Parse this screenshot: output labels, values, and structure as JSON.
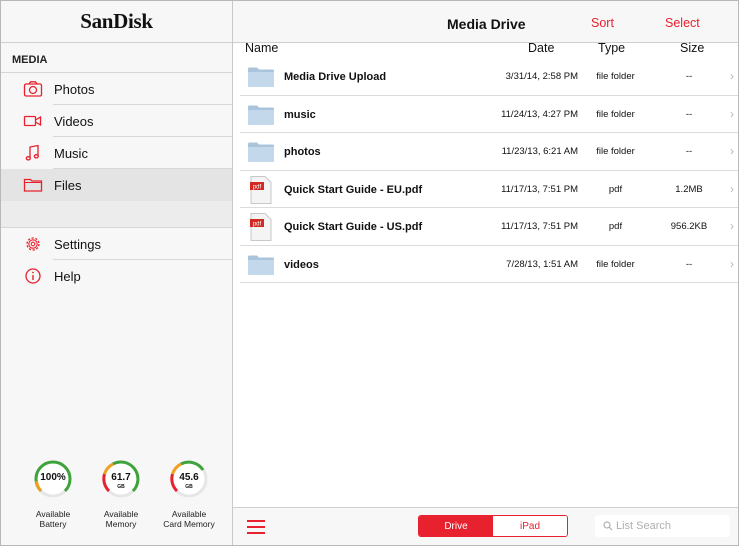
{
  "brand": "SanDisk",
  "sidebar": {
    "section_label": "MEDIA",
    "items": [
      {
        "label": "Photos",
        "icon": "camera-icon"
      },
      {
        "label": "Videos",
        "icon": "video-camera-icon"
      },
      {
        "label": "Music",
        "icon": "music-note-icon"
      },
      {
        "label": "Files",
        "icon": "folder-icon",
        "selected": true
      }
    ],
    "items2": [
      {
        "label": "Settings",
        "icon": "gear-icon"
      },
      {
        "label": "Help",
        "icon": "info-icon"
      }
    ],
    "gauges": [
      {
        "value": "100%",
        "unit": "",
        "label1": "Available",
        "label2": "Battery"
      },
      {
        "value": "61.7",
        "unit": "GB",
        "label1": "Available",
        "label2": "Memory"
      },
      {
        "value": "45.6",
        "unit": "GB",
        "label1": "Available",
        "label2": "Card Memory"
      }
    ]
  },
  "header": {
    "title": "Media Drive",
    "sort_label": "Sort",
    "select_label": "Select"
  },
  "columns": {
    "name": "Name",
    "date": "Date",
    "type": "Type",
    "size": "Size"
  },
  "files": [
    {
      "name": "Media Drive Upload",
      "date": "3/31/14, 2:58 PM",
      "type": "file folder",
      "size": "--",
      "kind": "folder"
    },
    {
      "name": "music",
      "date": "11/24/13, 4:27 PM",
      "type": "file folder",
      "size": "--",
      "kind": "folder"
    },
    {
      "name": "photos",
      "date": "11/23/13, 6:21 AM",
      "type": "file folder",
      "size": "--",
      "kind": "folder"
    },
    {
      "name": "Quick Start Guide - EU.pdf",
      "date": "11/17/13, 7:51 PM",
      "type": "pdf",
      "size": "1.2MB",
      "kind": "pdf"
    },
    {
      "name": "Quick Start Guide - US.pdf",
      "date": "11/17/13, 7:51 PM",
      "type": "pdf",
      "size": "956.2KB",
      "kind": "pdf"
    },
    {
      "name": "videos",
      "date": "7/28/13, 1:51 AM",
      "type": "file folder",
      "size": "--",
      "kind": "folder"
    }
  ],
  "pdf_badge": "pdf",
  "bottom": {
    "segments": [
      "Drive",
      "iPad"
    ],
    "active_segment": "Drive",
    "search_placeholder": "List Search"
  },
  "colors": {
    "accent": "#e8212e"
  }
}
